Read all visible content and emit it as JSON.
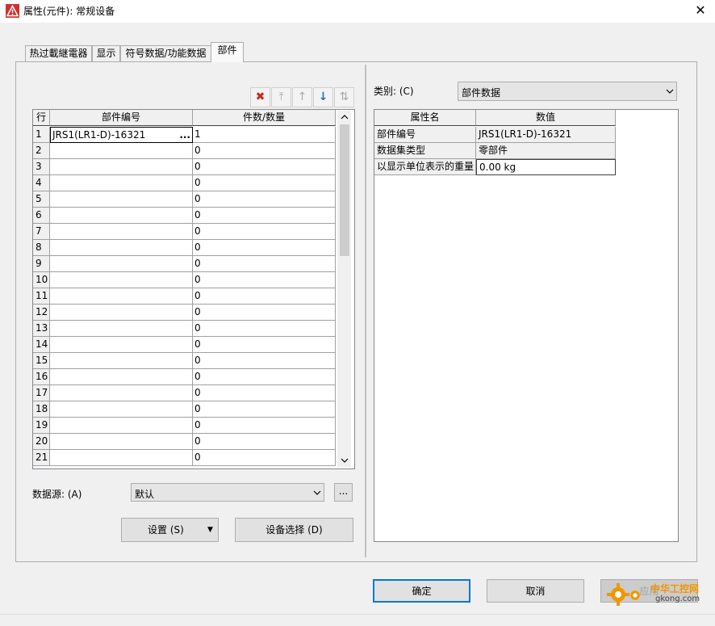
{
  "window": {
    "title": "属性(元件): 常规设备",
    "close_glyph": "✕"
  },
  "tabs": [
    {
      "label": "热过載継電器",
      "active": false
    },
    {
      "label": "显示",
      "active": false
    },
    {
      "label": "符号数据/功能数据",
      "active": false
    },
    {
      "label": "部件",
      "active": true
    }
  ],
  "toolbar": {
    "delete": "✖",
    "move_top": "⤒",
    "move_up": "↑",
    "move_down": "↓",
    "swap": "⇅"
  },
  "parts_table": {
    "headers": {
      "row": "行",
      "part_number": "部件编号",
      "quantity": "件数/数量"
    },
    "rows": [
      {
        "n": "1",
        "part": "JRS1(LR1-D)-16321",
        "qty": "1",
        "browse": "..."
      },
      {
        "n": "2",
        "part": "",
        "qty": "0"
      },
      {
        "n": "3",
        "part": "",
        "qty": "0"
      },
      {
        "n": "4",
        "part": "",
        "qty": "0"
      },
      {
        "n": "5",
        "part": "",
        "qty": "0"
      },
      {
        "n": "6",
        "part": "",
        "qty": "0"
      },
      {
        "n": "7",
        "part": "",
        "qty": "0"
      },
      {
        "n": "8",
        "part": "",
        "qty": "0"
      },
      {
        "n": "9",
        "part": "",
        "qty": "0"
      },
      {
        "n": "10",
        "part": "",
        "qty": "0"
      },
      {
        "n": "11",
        "part": "",
        "qty": "0"
      },
      {
        "n": "12",
        "part": "",
        "qty": "0"
      },
      {
        "n": "13",
        "part": "",
        "qty": "0"
      },
      {
        "n": "14",
        "part": "",
        "qty": "0"
      },
      {
        "n": "15",
        "part": "",
        "qty": "0"
      },
      {
        "n": "16",
        "part": "",
        "qty": "0"
      },
      {
        "n": "17",
        "part": "",
        "qty": "0"
      },
      {
        "n": "18",
        "part": "",
        "qty": "0"
      },
      {
        "n": "19",
        "part": "",
        "qty": "0"
      },
      {
        "n": "20",
        "part": "",
        "qty": "0"
      },
      {
        "n": "21",
        "part": "",
        "qty": "0"
      }
    ]
  },
  "data_source": {
    "label": "数据源: (A)",
    "value": "默认",
    "more": "..."
  },
  "buttons": {
    "settings": "设置 (S)",
    "device_select": "设备选择 (D)",
    "ok": "确定",
    "cancel": "取消",
    "apply": "应用"
  },
  "category": {
    "label": "类别: (C)",
    "value": "部件数据"
  },
  "properties": {
    "headers": {
      "name": "属性名",
      "value": "数值"
    },
    "rows": [
      {
        "name": "部件编号",
        "value": "JRS1(LR1-D)-16321"
      },
      {
        "name": "数据集类型",
        "value": "零部件"
      },
      {
        "name": "以显示单位表示的重量",
        "value": "0.00 kg"
      }
    ]
  },
  "watermark": {
    "line1": "中华工控网",
    "line2": "gkong.com"
  },
  "colors": {
    "accent": "#0078d7",
    "delete_red": "#c42b1c",
    "down_blue": "#1e6fc9",
    "watermark_orange": "#f29600"
  }
}
